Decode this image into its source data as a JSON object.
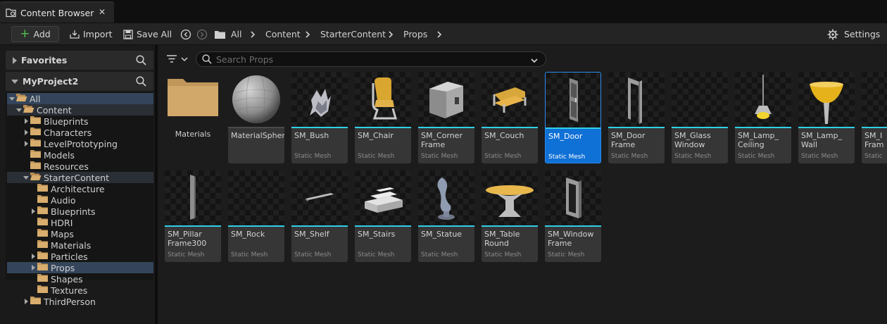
{
  "tab": {
    "title": "Content Browser",
    "close": "✕"
  },
  "toolbar": {
    "add_label": "Add",
    "import_label": "Import",
    "save_all_label": "Save All",
    "breadcrumbs": [
      "All",
      "Content",
      "StarterContent",
      "Props"
    ],
    "settings_label": "Settings"
  },
  "sidebar": {
    "favorites_label": "Favorites",
    "project_label": "MyProject2",
    "tree": [
      {
        "label": "All",
        "indent": 0,
        "state": "open",
        "style": "sel"
      },
      {
        "label": "Content",
        "indent": 1,
        "state": "open",
        "style": "hl"
      },
      {
        "label": "Blueprints",
        "indent": 2,
        "state": "closed",
        "style": ""
      },
      {
        "label": "Characters",
        "indent": 2,
        "state": "closed",
        "style": ""
      },
      {
        "label": "LevelPrototyping",
        "indent": 2,
        "state": "closed",
        "style": ""
      },
      {
        "label": "Models",
        "indent": 2,
        "state": "none",
        "style": ""
      },
      {
        "label": "Resources",
        "indent": 2,
        "state": "none",
        "style": ""
      },
      {
        "label": "StarterContent",
        "indent": 2,
        "state": "open",
        "style": "hl"
      },
      {
        "label": "Architecture",
        "indent": 3,
        "state": "none",
        "style": ""
      },
      {
        "label": "Audio",
        "indent": 3,
        "state": "none",
        "style": ""
      },
      {
        "label": "Blueprints",
        "indent": 3,
        "state": "closed",
        "style": ""
      },
      {
        "label": "HDRI",
        "indent": 3,
        "state": "none",
        "style": ""
      },
      {
        "label": "Maps",
        "indent": 3,
        "state": "none",
        "style": ""
      },
      {
        "label": "Materials",
        "indent": 3,
        "state": "none",
        "style": ""
      },
      {
        "label": "Particles",
        "indent": 3,
        "state": "closed",
        "style": ""
      },
      {
        "label": "Props",
        "indent": 3,
        "state": "closed",
        "style": "sel"
      },
      {
        "label": "Shapes",
        "indent": 3,
        "state": "none",
        "style": ""
      },
      {
        "label": "Textures",
        "indent": 3,
        "state": "none",
        "style": ""
      },
      {
        "label": "ThirdPerson",
        "indent": 2,
        "state": "closed",
        "style": ""
      }
    ]
  },
  "search": {
    "placeholder": "Search Props"
  },
  "folder": {
    "name": "Materials"
  },
  "assets": [
    {
      "name": "MaterialSphere",
      "type": "",
      "icon": "sphere-icon",
      "selected": false
    },
    {
      "name": "SM_Bush",
      "type": "Static Mesh",
      "icon": "bush-icon",
      "selected": false
    },
    {
      "name": "SM_Chair",
      "type": "Static Mesh",
      "icon": "chair-icon",
      "selected": false
    },
    {
      "name": "SM_Corner\nFrame",
      "type": "Static Mesh",
      "icon": "corner-frame-icon",
      "selected": false
    },
    {
      "name": "SM_Couch",
      "type": "Static Mesh",
      "icon": "couch-icon",
      "selected": false
    },
    {
      "name": "SM_Door",
      "type": "Static Mesh",
      "icon": "door-icon",
      "selected": true
    },
    {
      "name": "SM_Door\nFrame",
      "type": "Static Mesh",
      "icon": "door-frame-icon",
      "selected": false
    },
    {
      "name": "SM_Glass\nWindow",
      "type": "Static Mesh",
      "icon": "glass-window-icon",
      "selected": false
    },
    {
      "name": "SM_Lamp_\nCeiling",
      "type": "Static Mesh",
      "icon": "ceiling-lamp-icon",
      "selected": false
    },
    {
      "name": "SM_Lamp_\nWall",
      "type": "Static Mesh",
      "icon": "wall-lamp-icon",
      "selected": false
    },
    {
      "name": "SM_I\nFram",
      "type": "Static",
      "icon": "frame-icon",
      "selected": false
    },
    {
      "name": "SM_Pillar\nFrame300",
      "type": "Static Mesh",
      "icon": "pillar-icon",
      "selected": false
    },
    {
      "name": "SM_Rock",
      "type": "Static Mesh",
      "icon": "rock-icon",
      "selected": false
    },
    {
      "name": "SM_Shelf",
      "type": "Static Mesh",
      "icon": "shelf-icon",
      "selected": false
    },
    {
      "name": "SM_Stairs",
      "type": "Static Mesh",
      "icon": "stairs-icon",
      "selected": false
    },
    {
      "name": "SM_Statue",
      "type": "Static Mesh",
      "icon": "statue-icon",
      "selected": false
    },
    {
      "name": "SM_Table\nRound",
      "type": "Static Mesh",
      "icon": "round-table-icon",
      "selected": false
    },
    {
      "name": "SM_Window\nFrame",
      "type": "Static Mesh",
      "icon": "window-frame-icon",
      "selected": false
    }
  ],
  "colors": {
    "accent_cyan": "#2fd0e8",
    "selection_blue": "#0f70d6",
    "folder_tan": "#c0965a",
    "add_green": "#4fc24f"
  }
}
